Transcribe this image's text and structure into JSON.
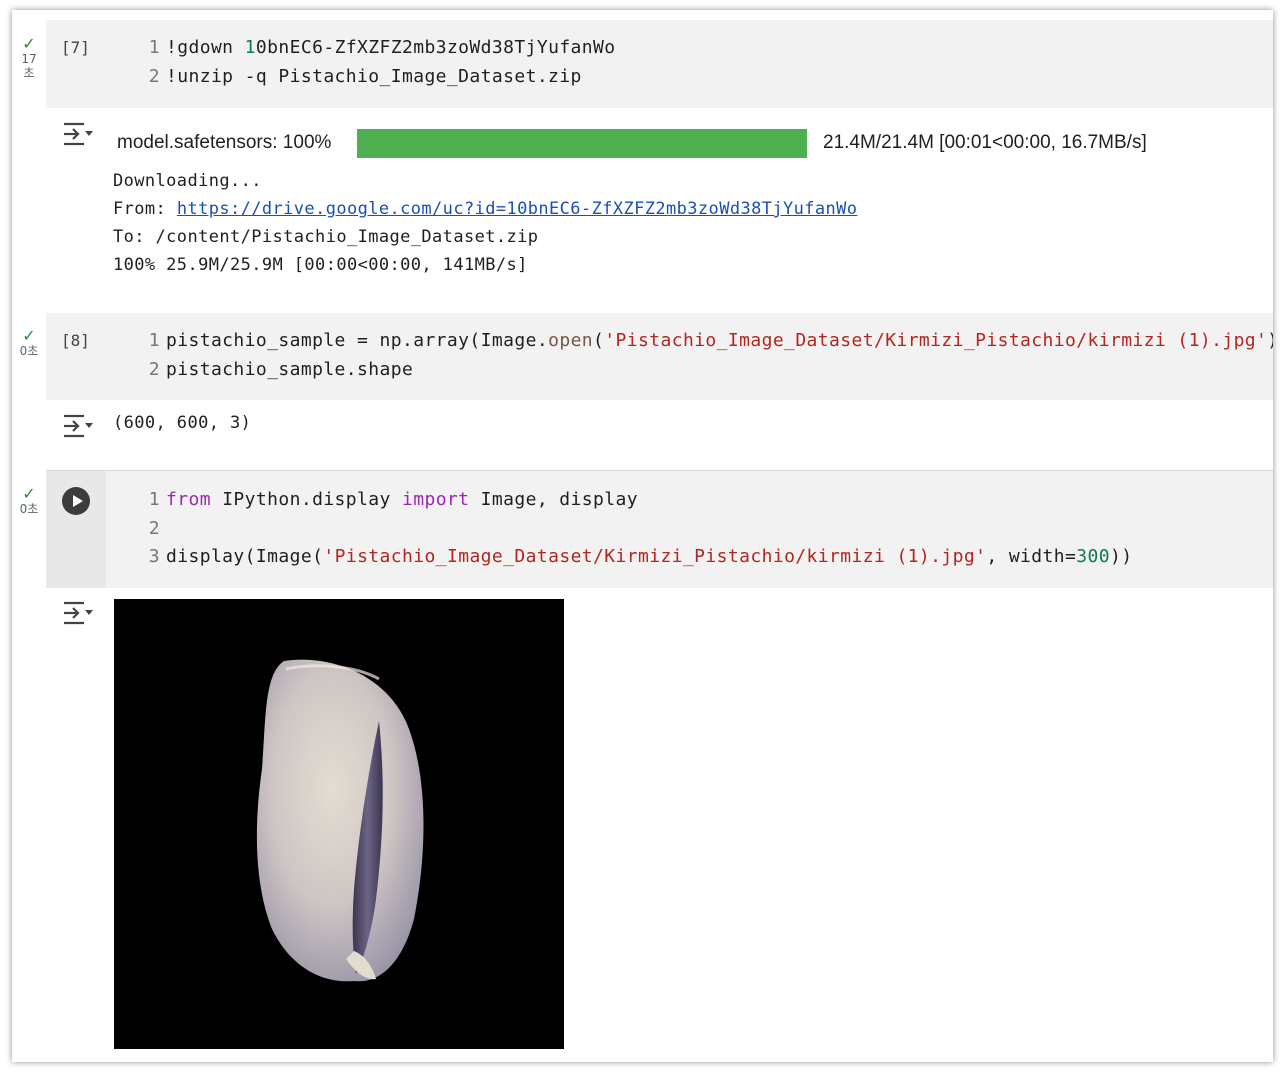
{
  "cells": [
    {
      "exec_count": "[7]",
      "duration_num": "17",
      "duration_unit": "초",
      "code_lines": [
        {
          "n": "1",
          "p1": "!gdown ",
          "num": "1",
          "p2": "0bnEC6-ZfXZFZ2mb3zoWd38TjYufanWo"
        },
        {
          "n": "2",
          "text": "!unzip -q Pistachio_Image_Dataset.zip"
        }
      ],
      "output": {
        "progress_label": "model.safetensors: 100%",
        "progress_value": 1.0,
        "progress_stats": "21.4M/21.4M [00:01<00:00, 16.7MB/s]",
        "downloading": "Downloading...",
        "from_label": "From: ",
        "from_url": "https://drive.google.com/uc?id=10bnEC6-ZfXZFZ2mb3zoWd38TjYufanWo",
        "to_line": "To: /content/Pistachio_Image_Dataset.zip",
        "done_line": "100% 25.9M/25.9M [00:00<00:00, 141MB/s]"
      }
    },
    {
      "exec_count": "[8]",
      "duration": "0초",
      "code_lines": [
        {
          "n": "1",
          "var": "pistachio_sample = np.array",
          "p": "(",
          "cls": "Image",
          "dot": ".",
          "meth": "open",
          "p2": "(",
          "str": "'Pistachio_Image_Dataset/Kirmizi_Pistachio/kirmizi (1).jpg'",
          "close": "))"
        },
        {
          "n": "2",
          "text": "pistachio_sample.shape"
        }
      ],
      "output": {
        "text": "(600, 600, 3)"
      }
    },
    {
      "duration": "0초",
      "code_lines": [
        {
          "n": "1",
          "kw1": "from",
          "mod": " IPython.display ",
          "kw2": "import",
          "rest": " Image, display"
        },
        {
          "n": "2",
          "text": ""
        },
        {
          "n": "3",
          "fn": "display",
          "p1": "(",
          "cls": "Image",
          "p2": "(",
          "str": "'Pistachio_Image_Dataset/Kirmizi_Pistachio/kirmizi (1).jpg'",
          "mid": ", width=",
          "num": "300",
          "close": "))"
        }
      ],
      "output": {
        "image_alt": "pistachio image"
      }
    }
  ],
  "icons": {
    "check": "check-icon",
    "output_toggle": "output-toggle-icon",
    "run": "run-cell-icon"
  },
  "colors": {
    "progress_fill": "#4caf50",
    "check": "#1e8e3e",
    "keyword": "#9c27b0",
    "string": "#b3261e",
    "number": "#0b7a55",
    "link": "#1a4fb5"
  }
}
